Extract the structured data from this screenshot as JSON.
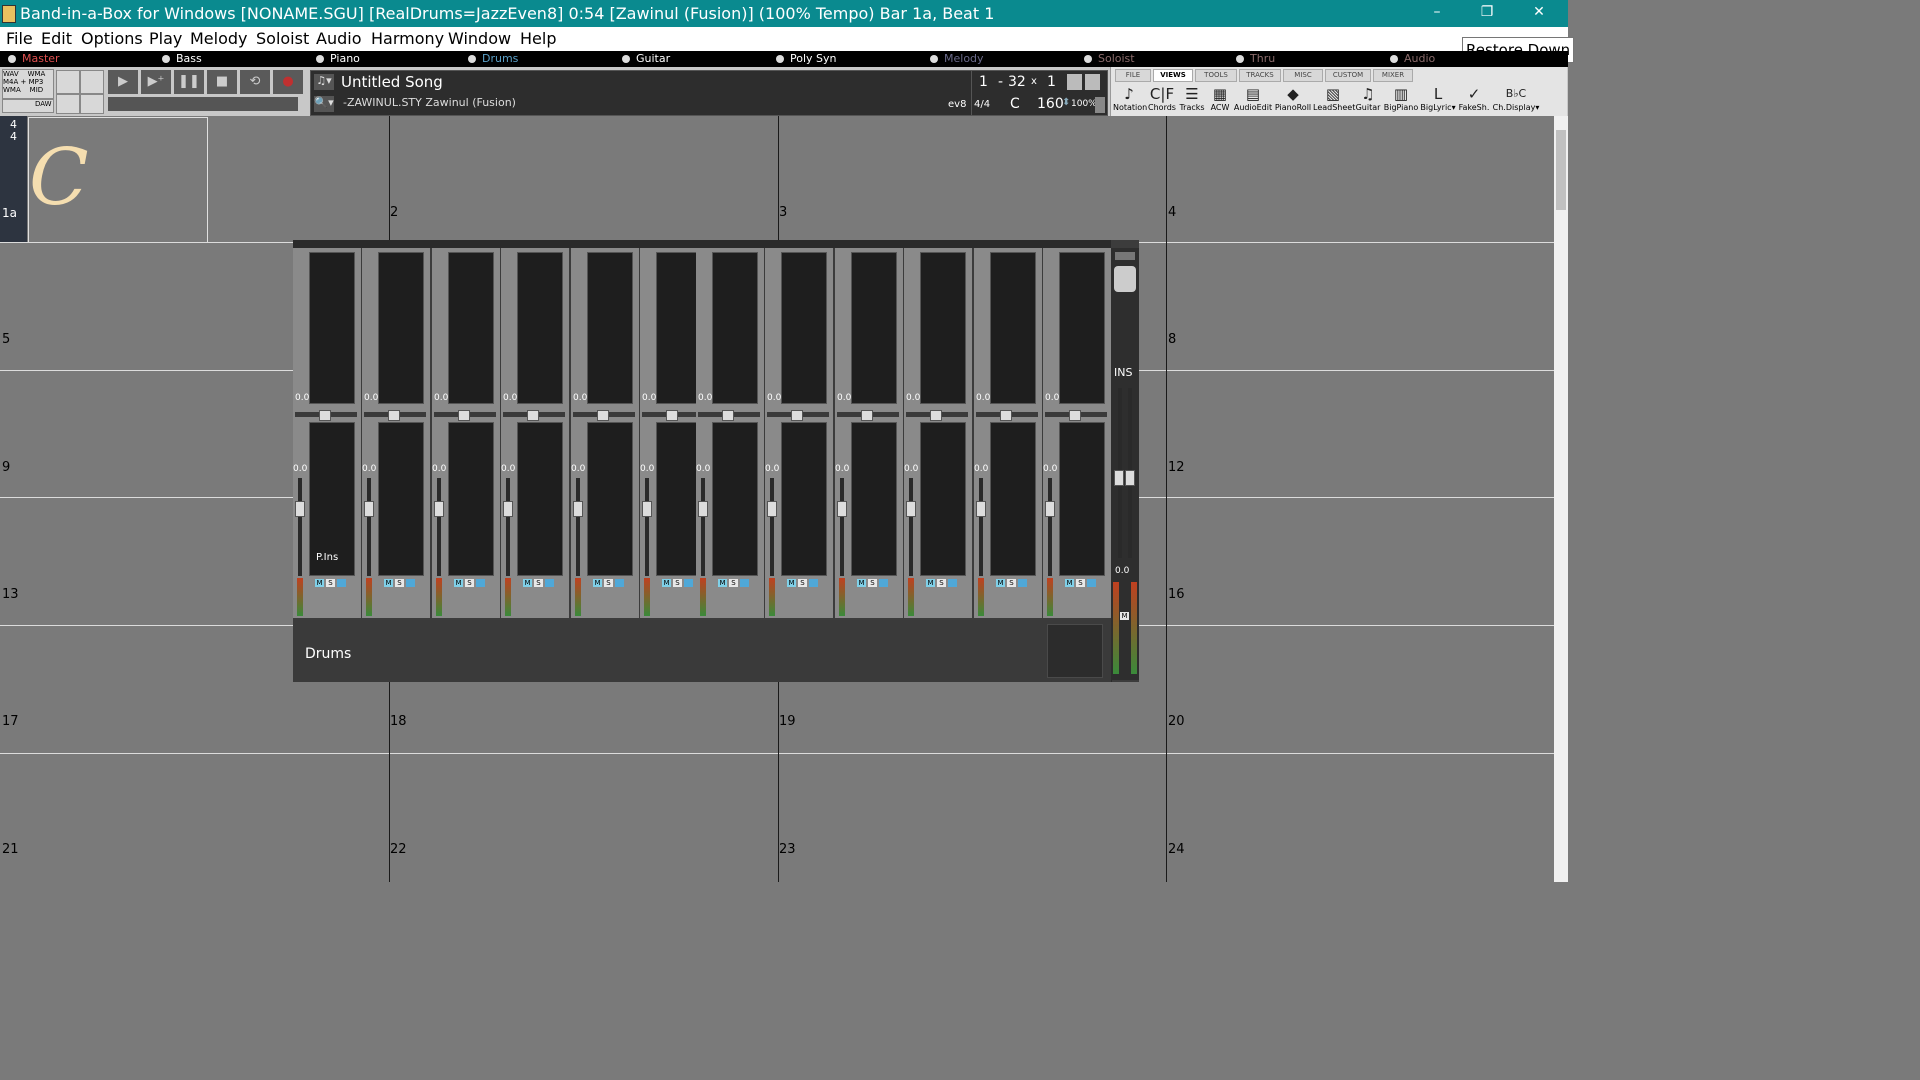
{
  "window": {
    "title": "Band-in-a-Box for Windows  [NONAME.SGU] [RealDrums=JazzEven8]   0:54  [Zawinul (Fusion)] (100% Tempo)  Bar 1a, Beat 1",
    "minimize": "–",
    "restore": "❐",
    "close": "✕",
    "tooltip": "Restore Down"
  },
  "menu": [
    "File",
    "Edit",
    "Options",
    "Play",
    "Melody",
    "Soloist",
    "Audio",
    "Harmony",
    "Window",
    "Help"
  ],
  "tracks": [
    {
      "label": "Master",
      "color": "#e05050"
    },
    {
      "label": "Bass",
      "color": "#ffffff"
    },
    {
      "label": "Drums",
      "color": "#5aa0c8"
    },
    {
      "label": "Piano",
      "color": "#ffffff"
    },
    {
      "label": "Guitar",
      "color": "#ffffff"
    },
    {
      "label": "Poly Syn",
      "color": "#ffffff"
    },
    {
      "label": "Melody",
      "color": "#6a6a8a"
    },
    {
      "label": "Soloist",
      "color": "#8a6a6a"
    },
    {
      "label": "Thru",
      "color": "#8a6a6a"
    },
    {
      "label": "Audio",
      "color": "#8a6a6a"
    }
  ],
  "toolbar": {
    "save_formats": [
      "WAV",
      "WMA",
      "M4A",
      "+",
      "MP3",
      "WMA",
      "MID"
    ],
    "daw_label": "DAW",
    "song_title": "Untitled Song",
    "style_file": "-ZAWINUL.STY Zawinul (Fusion)",
    "start_bar": "1",
    "dash": "-",
    "end_bar": "32",
    "times": "x",
    "choruses": "1",
    "feel": "ev8",
    "time_sig": "4/4",
    "key": "C",
    "tempo": "160",
    "tempo_pct": "100%"
  },
  "views_panel": {
    "tabs": [
      "FILE",
      "VIEWS",
      "TOOLS",
      "TRACKS",
      "MISC",
      "CUSTOM",
      "MIXER"
    ],
    "active_tab": "VIEWS",
    "items": [
      {
        "label": "Notation",
        "glyph": "♪"
      },
      {
        "label": "Chords",
        "glyph": "C|F"
      },
      {
        "label": "Tracks",
        "glyph": "☰"
      },
      {
        "label": "ACW",
        "glyph": "▦"
      },
      {
        "label": "AudioEdit",
        "glyph": "▤"
      },
      {
        "label": "PianoRoll",
        "glyph": "◆"
      },
      {
        "label": "LeadSheet",
        "glyph": "▧"
      },
      {
        "label": "Guitar",
        "glyph": "♫"
      },
      {
        "label": "BigPiano",
        "glyph": "▥"
      },
      {
        "label": "BigLyric▾",
        "glyph": "L"
      },
      {
        "label": "FakeSh.",
        "glyph": "✓"
      },
      {
        "label": "Ch.Display▾",
        "glyph": "B♭C"
      }
    ]
  },
  "sheet": {
    "time_sig_top": "4",
    "time_sig_bottom": "4",
    "first_bar_label": "1a",
    "first_chord": "C",
    "bar_numbers": [
      "2",
      "3",
      "4",
      "5",
      "8",
      "9",
      "12",
      "13",
      "16",
      "17",
      "18",
      "19",
      "20",
      "21",
      "22",
      "23",
      "24"
    ]
  },
  "mixer": {
    "value_label": "0.0",
    "pins_label": "P.Ins",
    "ins_label": "INS",
    "track_label": "Drums",
    "m": "M",
    "s": "S",
    "strip_count": 12
  }
}
